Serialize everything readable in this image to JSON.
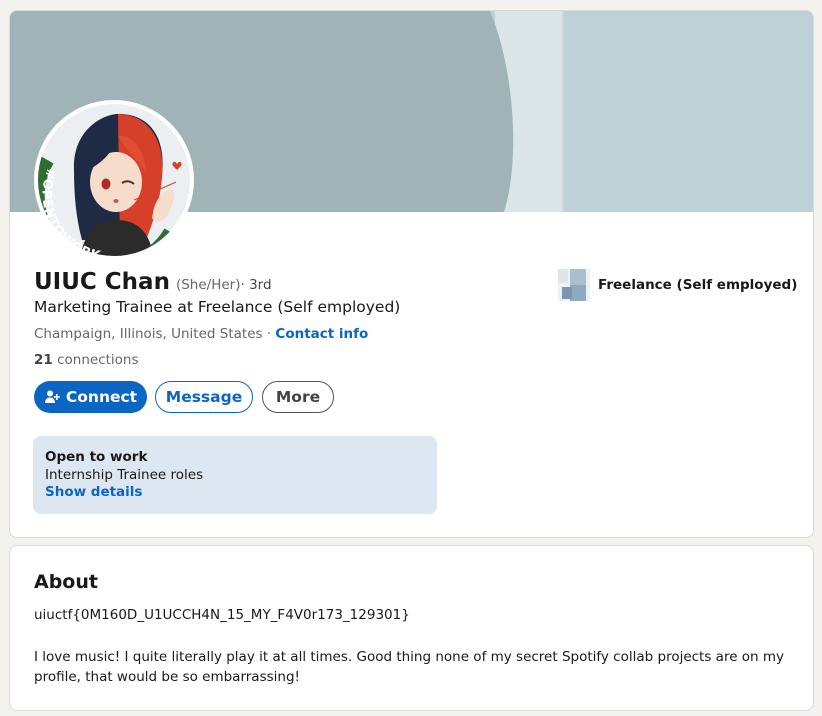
{
  "colors": {
    "page_bg": "#f4f2ee",
    "accent": "#0a66c2",
    "banner_gray": "#a0b3b6",
    "banner_light": "#bdd1d6",
    "open_to_work_green": "#2f6e33",
    "open_to_work_bg": "#dde7f1"
  },
  "profile": {
    "name": "UIUC Chan",
    "pronouns": "(She/Her)",
    "degree": " · 3rd",
    "headline": "Marketing Trainee at Freelance (Self employed)",
    "location": "Champaign, Illinois, United States",
    "separator": " · ",
    "contact_label": "Contact info",
    "connections_count": "21",
    "connections_label": " connections",
    "avatar_badge": "#OPENTOWORK"
  },
  "actions": {
    "connect_label": "Connect",
    "message_label": "Message",
    "more_label": "More"
  },
  "open_to_work": {
    "title": "Open to work",
    "roles": "Internship Trainee roles",
    "link": "Show details"
  },
  "company": {
    "name": "Freelance (Self employed)"
  },
  "about": {
    "title": "About",
    "flag": "uiuctf{0M160D_U1UCCH4N_15_MY_F4V0r173_129301}",
    "text": "I love music! I quite literally play it at all times. Good thing none of my secret Spotify collab projects are on my profile, that would be so embarrassing!"
  },
  "icons": {
    "connect": "add-person-icon",
    "company_logo": "company-logo-icon"
  }
}
